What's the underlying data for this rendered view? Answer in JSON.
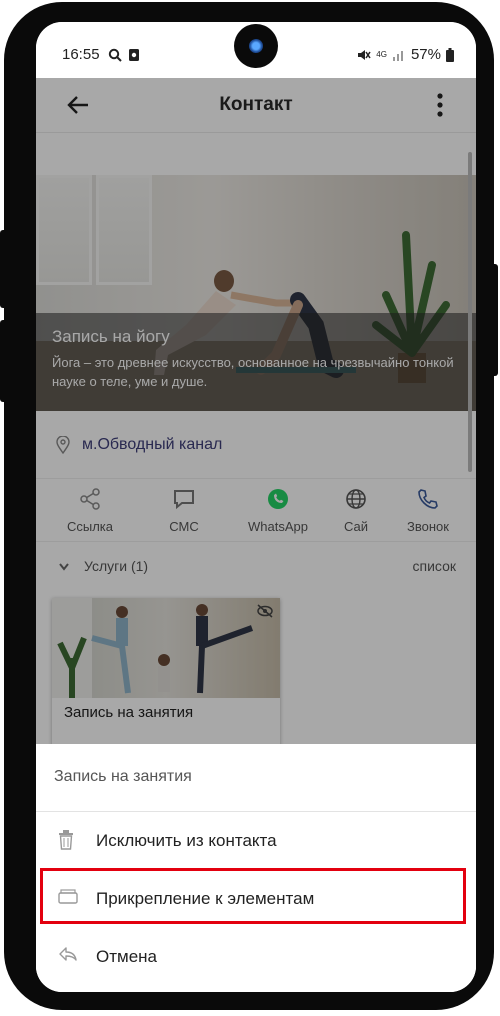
{
  "status_bar": {
    "time": "16:55",
    "battery": "57%",
    "network": "4G"
  },
  "header": {
    "title": "Контакт",
    "back_icon": "arrow-left-icon",
    "menu_icon": "more-vertical-icon"
  },
  "banner": {
    "title": "Запись на йогу",
    "description": "Йога – это древнее искусство, основанное на чрезвычайно тонкой науке о теле, уме и душе."
  },
  "address": {
    "text": "м.Обводный канал",
    "icon": "location-pin-icon"
  },
  "actions": [
    {
      "label": "Ссылка",
      "icon": "share-icon"
    },
    {
      "label": "СМС",
      "icon": "chat-icon"
    },
    {
      "label": "WhatsApp",
      "icon": "whatsapp-icon"
    },
    {
      "label": "Сай",
      "icon": "globe-icon"
    },
    {
      "label": "Звонок",
      "icon": "phone-icon"
    }
  ],
  "services": {
    "title": "Услуги (1)",
    "list_link": "список",
    "card": {
      "label": "Запись на занятия",
      "icon": "eye-off-icon"
    }
  },
  "sheet": {
    "header": "Запись на занятия",
    "options": [
      {
        "label": "Исключить из контакта",
        "icon": "trash-icon"
      },
      {
        "label": "Прикрепление к элементам",
        "icon": "folder-icon"
      },
      {
        "label": "Отмена",
        "icon": "undo-icon"
      }
    ]
  },
  "colors": {
    "highlight": "#e3000f",
    "whatsapp": "#25d366",
    "link_text": "#3f3f7a"
  }
}
